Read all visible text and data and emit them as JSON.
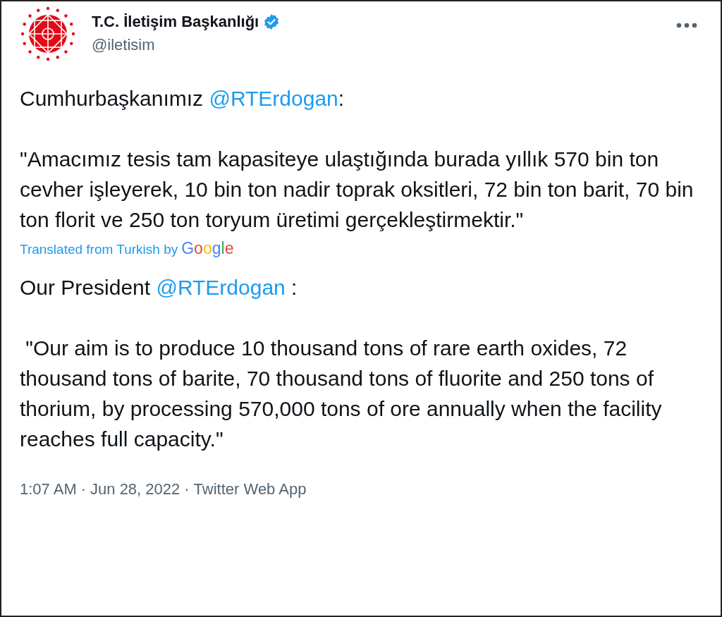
{
  "author": {
    "name": "T.C. İletişim Başkanlığı",
    "verified": true,
    "handle": "@iletisim"
  },
  "original": {
    "intro_before": "Cumhurbaşkanımız ",
    "mention": "@RTErdogan",
    "intro_after": ":",
    "quote": "\"Amacımız tesis tam kapasiteye ulaştığında burada yıllık 570 bin ton cevher işleyerek, 10 bin ton nadir toprak oksitleri, 72 bin ton barit, 70 bin ton florit ve 250 ton toryum üretimi gerçekleştirmektir.\""
  },
  "translation": {
    "label": "Translated from Turkish by",
    "provider": "Google",
    "intro_before": "Our President ",
    "mention": "@RTErdogan",
    "intro_after": " :",
    "quote": " \"Our aim is to produce 10 thousand tons of rare earth oxides, 72 thousand tons of barite, 70 thousand tons of fluorite and 250 tons of thorium, by processing 570,000 tons of ore annually when the facility reaches full capacity.\""
  },
  "footer": {
    "time": "1:07 AM",
    "separator_1": "·",
    "date": "Jun 28, 2022",
    "separator_2": "·",
    "source": "Twitter Web App"
  }
}
